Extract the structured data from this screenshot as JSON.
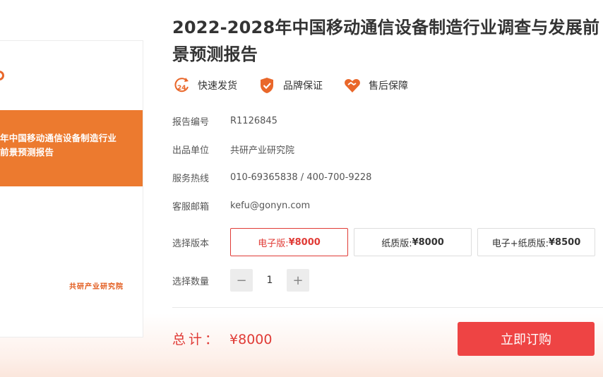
{
  "cover": {
    "title_line1": "年中国移动通信设备制造行业",
    "title_line2": "前景预测报告",
    "publisher": "共研产业研究院"
  },
  "product": {
    "title": "2022-2028年中国移动通信设备制造行业调查与发展前景预测报告"
  },
  "features": [
    {
      "icon": "delivery-24h-icon",
      "label": "快速发货"
    },
    {
      "icon": "shield-check-icon",
      "label": "品牌保证"
    },
    {
      "icon": "heart-handshake-icon",
      "label": "售后保障"
    }
  ],
  "info": {
    "report_no_label": "报告编号",
    "report_no": "R1126845",
    "publisher_label": "出品单位",
    "publisher": "共研产业研究院",
    "hotline_label": "服务热线",
    "hotline": "010-69365838 / 400-700-9228",
    "email_label": "客服邮箱",
    "email": "kefu@gonyn.com"
  },
  "version": {
    "label": "选择版本",
    "options": [
      {
        "name": "电子版: ",
        "price": "¥8000",
        "selected": true
      },
      {
        "name": "纸质版: ",
        "price": "¥8000",
        "selected": false
      },
      {
        "name": "电子+纸质版: ",
        "price": "¥8500",
        "selected": false
      }
    ]
  },
  "quantity": {
    "label": "选择数量",
    "minus": "−",
    "value": "1",
    "plus": "+"
  },
  "total": {
    "label": "总计：",
    "price": "¥8000"
  },
  "buy_button": "立即订购",
  "colors": {
    "accent": "#e03b36",
    "orange": "#ec7a2f",
    "buy": "#ee4444"
  }
}
